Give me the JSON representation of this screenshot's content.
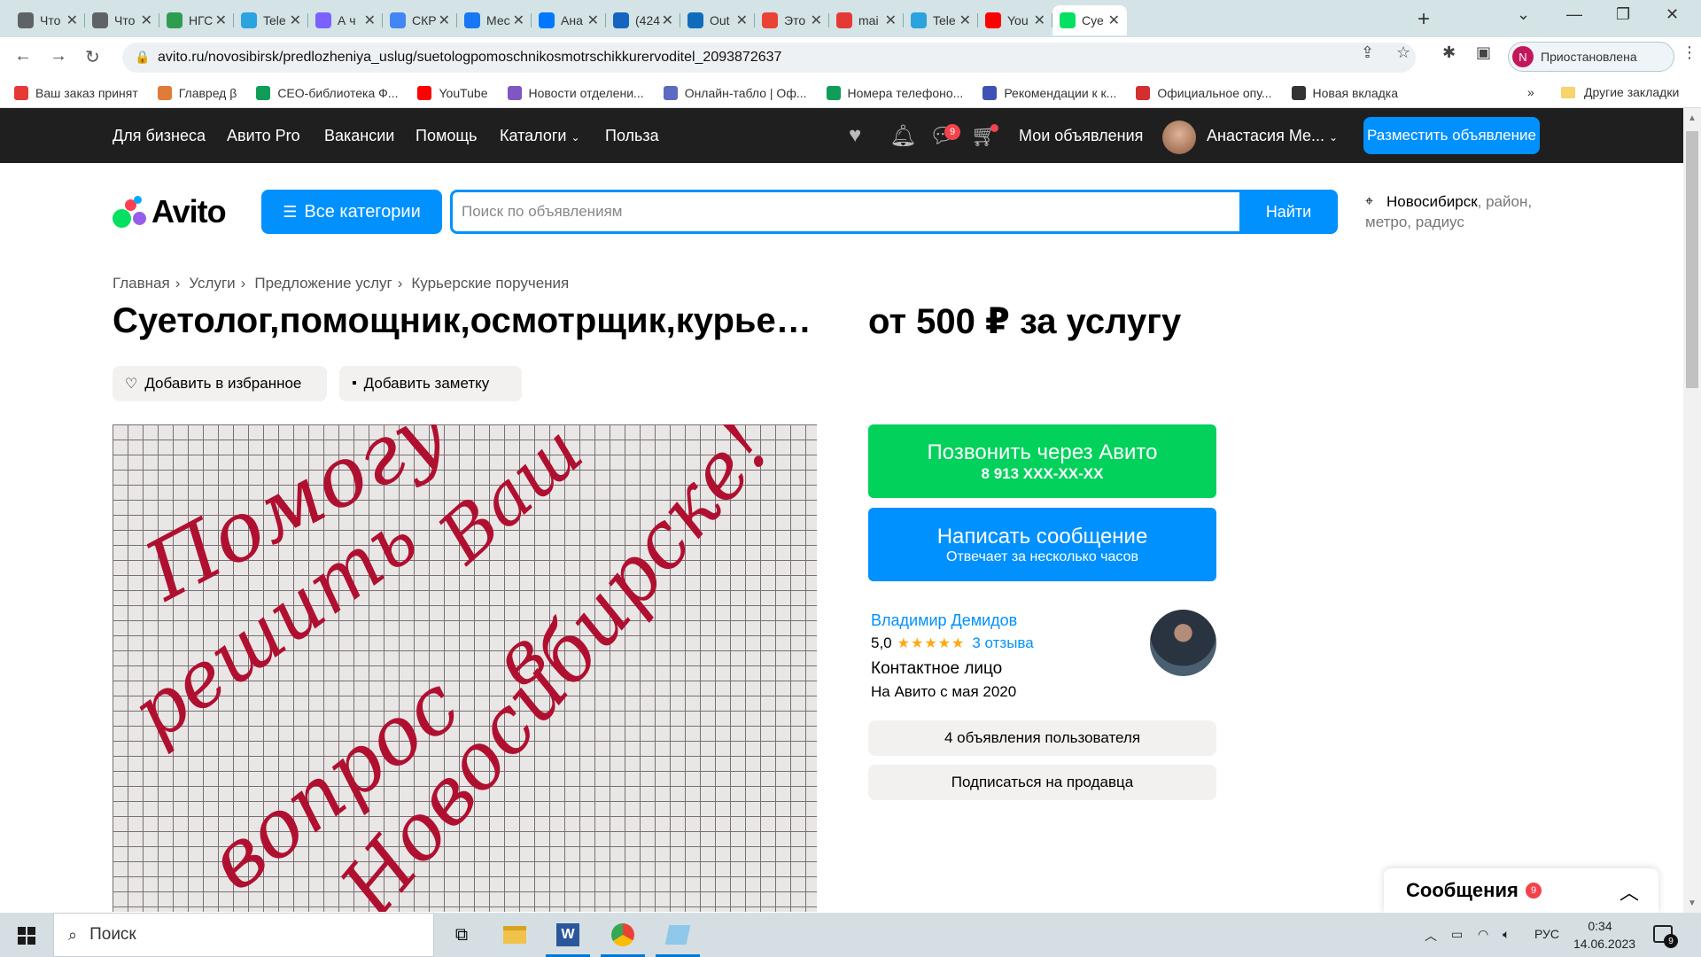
{
  "browser": {
    "tabs": [
      {
        "label": "Что",
        "color": "#5f6368"
      },
      {
        "label": "Что",
        "color": "#5f6368"
      },
      {
        "label": "НГС",
        "color": "#2e9d4f"
      },
      {
        "label": "Tele",
        "color": "#2aa3df"
      },
      {
        "label": "А ч",
        "color": "#7b61ff"
      },
      {
        "label": "СКР",
        "color": "#4285f4"
      },
      {
        "label": "Мес",
        "color": "#1877f2"
      },
      {
        "label": "Ана",
        "color": "#0077ff"
      },
      {
        "label": "(424",
        "color": "#1565c0"
      },
      {
        "label": "Out",
        "color": "#0f6cbd"
      },
      {
        "label": "Это",
        "color": "#ea4335"
      },
      {
        "label": "mai",
        "color": "#e53935"
      },
      {
        "label": "Tele",
        "color": "#2aa3df"
      },
      {
        "label": "You",
        "color": "#ff0000"
      },
      {
        "label": "Суе",
        "color": "#04e061",
        "active": true
      }
    ],
    "close_glyph": "✕",
    "new_tab_glyph": "+",
    "url": "avito.ru/novosibirsk/predlozheniya_uslug/suetologpomoschnikosmotrschikkurervoditel_2093872637",
    "profile_initial": "N",
    "profile_status": "Приостановлена",
    "bookmarks": [
      {
        "label": "Ваш заказ принят",
        "color": "#e53935"
      },
      {
        "label": "Главред β",
        "color": "#e07b39"
      },
      {
        "label": "СЕО-библиотека Ф...",
        "color": "#0f9d58"
      },
      {
        "label": "YouTube",
        "color": "#ff0000"
      },
      {
        "label": "Новости отделени...",
        "color": "#7e57c2"
      },
      {
        "label": "Онлайн-табло | Оф...",
        "color": "#5c6bc0"
      },
      {
        "label": "Номера телефоно...",
        "color": "#0f9d58"
      },
      {
        "label": "Рекомендации к к...",
        "color": "#3f51b5"
      },
      {
        "label": "Официальное опу...",
        "color": "#d32f2f"
      },
      {
        "label": "Новая вкладка",
        "color": "#333333"
      }
    ],
    "bookmarks_more": "»",
    "other_bookmarks": "Другие закладки"
  },
  "avito_nav": {
    "links": [
      "Для бизнеса",
      "Авито Pro",
      "Вакансии",
      "Помощь",
      "Каталоги",
      "Польза"
    ],
    "messages_badge": "9",
    "my_ads": "Мои объявления",
    "user_name": "Анастасия Ме...",
    "post_button": "Разместить объявление"
  },
  "header": {
    "logo": "Avito",
    "categories_button": "Все категории",
    "search_placeholder": "Поиск по объявлениям",
    "search_button": "Найти",
    "location_city": "Новосибирск",
    "location_rest_1": ", район,",
    "location_rest_2a": "метро",
    "location_comma": ", ",
    "location_rest_2b": "радиус"
  },
  "breadcrumbs": [
    "Главная",
    "Услуги",
    "Предложение услуг",
    "Курьерские поручения"
  ],
  "listing": {
    "title": "Суетолог,помощник,осмотрщик,курьер,водитель",
    "price": "от 500 ₽ за услугу",
    "favorite_button": "Добавить в избранное",
    "note_button": "Добавить заметку",
    "photo_text_lines": [
      "Помогу",
      "решить",
      "Ваш",
      "вопрос",
      "в",
      "Новосибирске!"
    ]
  },
  "contact": {
    "call_main": "Позвонить через Авито",
    "call_phone": "8 913 XXX-XX-XX",
    "message_main": "Написать сообщение",
    "message_sub": "Отвечает за несколько часов"
  },
  "seller": {
    "name": "Владимир Демидов",
    "rating": "5,0",
    "stars": "★★★★★",
    "reviews": "3 отзыва",
    "role": "Контактное лицо",
    "since": "На Авито с мая 2020",
    "ads_button": "4 объявления пользователя",
    "subscribe_button": "Подписаться на продавца"
  },
  "messages_panel": {
    "label": "Сообщения",
    "badge": "9"
  },
  "taskbar": {
    "search_label": "Поиск",
    "language": "РУС",
    "time": "0:34",
    "date": "14.06.2023",
    "notifications": "9"
  },
  "colors": {
    "avito_blue": "#0091ff",
    "avito_green": "#02d15c",
    "nav_black": "#1f1f1f"
  }
}
